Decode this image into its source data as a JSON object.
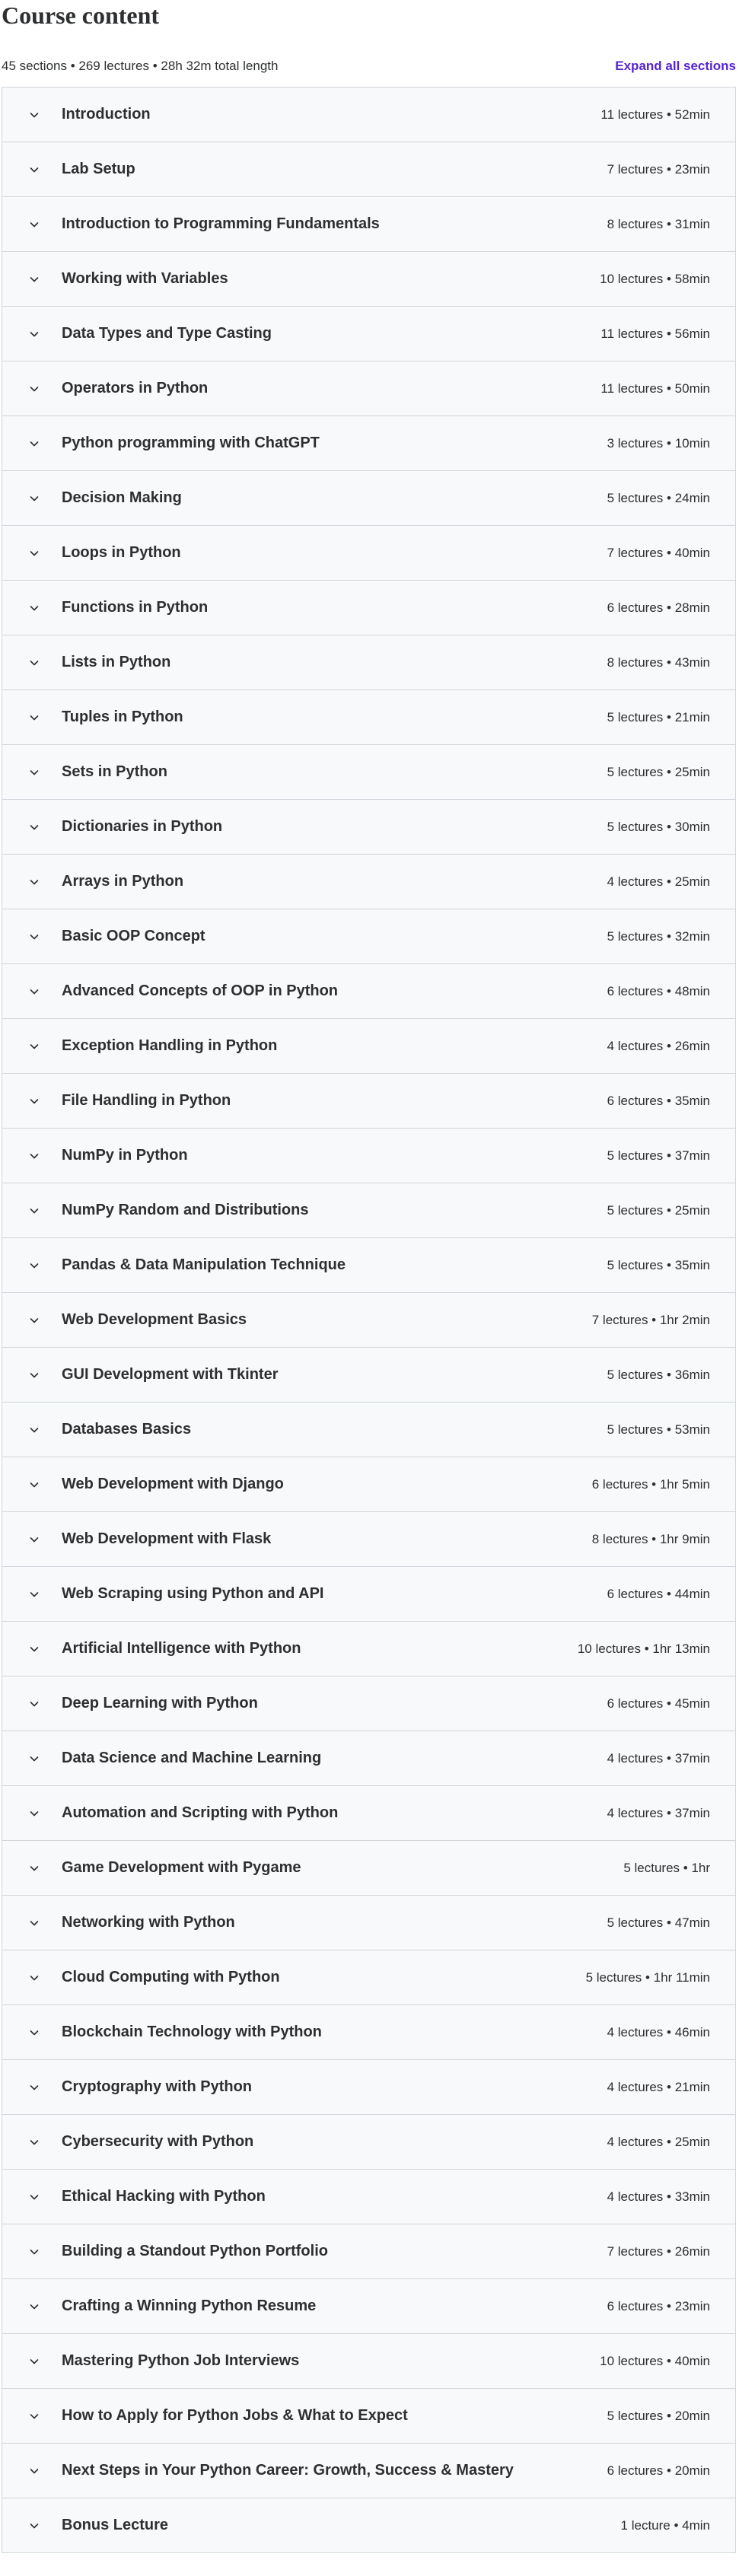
{
  "header": {
    "title": "Course content",
    "summary": "45 sections • 269 lectures • 28h 32m total length",
    "expand_all_label": "Expand all sections"
  },
  "icons": {
    "section_toggle": "chevron-down-icon"
  },
  "sections": [
    {
      "title": "Introduction",
      "meta": "11 lectures • 52min"
    },
    {
      "title": "Lab Setup",
      "meta": "7 lectures • 23min"
    },
    {
      "title": "Introduction to Programming Fundamentals",
      "meta": "8 lectures • 31min"
    },
    {
      "title": "Working with Variables",
      "meta": "10 lectures • 58min"
    },
    {
      "title": "Data Types and Type Casting",
      "meta": "11 lectures • 56min"
    },
    {
      "title": "Operators in Python",
      "meta": "11 lectures • 50min"
    },
    {
      "title": "Python programming with ChatGPT",
      "meta": "3 lectures • 10min"
    },
    {
      "title": "Decision Making",
      "meta": "5 lectures • 24min"
    },
    {
      "title": "Loops in Python",
      "meta": "7 lectures • 40min"
    },
    {
      "title": "Functions in Python",
      "meta": "6 lectures • 28min"
    },
    {
      "title": "Lists in Python",
      "meta": "8 lectures • 43min"
    },
    {
      "title": "Tuples in Python",
      "meta": "5 lectures • 21min"
    },
    {
      "title": "Sets in Python",
      "meta": "5 lectures • 25min"
    },
    {
      "title": "Dictionaries in Python",
      "meta": "5 lectures • 30min"
    },
    {
      "title": "Arrays in Python",
      "meta": "4 lectures • 25min"
    },
    {
      "title": "Basic OOP Concept",
      "meta": "5 lectures • 32min"
    },
    {
      "title": "Advanced Concepts of OOP in Python",
      "meta": "6 lectures • 48min"
    },
    {
      "title": "Exception Handling in Python",
      "meta": "4 lectures • 26min"
    },
    {
      "title": "File Handling in Python",
      "meta": "6 lectures • 35min"
    },
    {
      "title": "NumPy in Python",
      "meta": "5 lectures • 37min"
    },
    {
      "title": "NumPy Random and Distributions",
      "meta": "5 lectures • 25min"
    },
    {
      "title": "Pandas & Data Manipulation Technique",
      "meta": "5 lectures • 35min"
    },
    {
      "title": "Web Development Basics",
      "meta": "7 lectures • 1hr 2min"
    },
    {
      "title": "GUI Development with Tkinter",
      "meta": "5 lectures • 36min"
    },
    {
      "title": "Databases Basics",
      "meta": "5 lectures • 53min"
    },
    {
      "title": "Web Development with Django",
      "meta": "6 lectures • 1hr 5min"
    },
    {
      "title": "Web Development with Flask",
      "meta": "8 lectures • 1hr 9min"
    },
    {
      "title": "Web Scraping using Python and API",
      "meta": "6 lectures • 44min"
    },
    {
      "title": "Artificial Intelligence with Python",
      "meta": "10 lectures • 1hr 13min"
    },
    {
      "title": "Deep Learning with Python",
      "meta": "6 lectures • 45min"
    },
    {
      "title": "Data Science and Machine Learning",
      "meta": "4 lectures • 37min"
    },
    {
      "title": "Automation and Scripting with Python",
      "meta": "4 lectures • 37min"
    },
    {
      "title": "Game Development with Pygame",
      "meta": "5 lectures • 1hr"
    },
    {
      "title": "Networking with Python",
      "meta": "5 lectures • 47min"
    },
    {
      "title": "Cloud Computing with Python",
      "meta": "5 lectures • 1hr 11min"
    },
    {
      "title": "Blockchain Technology with Python",
      "meta": "4 lectures • 46min"
    },
    {
      "title": "Cryptography with Python",
      "meta": "4 lectures • 21min"
    },
    {
      "title": "Cybersecurity with Python",
      "meta": "4 lectures • 25min"
    },
    {
      "title": "Ethical Hacking with Python",
      "meta": "4 lectures • 33min"
    },
    {
      "title": "Building a Standout Python Portfolio",
      "meta": "7 lectures • 26min"
    },
    {
      "title": "Crafting a Winning Python Resume",
      "meta": "6 lectures • 23min"
    },
    {
      "title": "Mastering Python Job Interviews",
      "meta": "10 lectures • 40min"
    },
    {
      "title": "How to Apply for Python Jobs & What to Expect",
      "meta": "5 lectures • 20min"
    },
    {
      "title": "Next Steps in Your Python Career: Growth, Success & Mastery",
      "meta": "6 lectures • 20min"
    },
    {
      "title": "Bonus Lecture",
      "meta": "1 lecture • 4min"
    }
  ]
}
